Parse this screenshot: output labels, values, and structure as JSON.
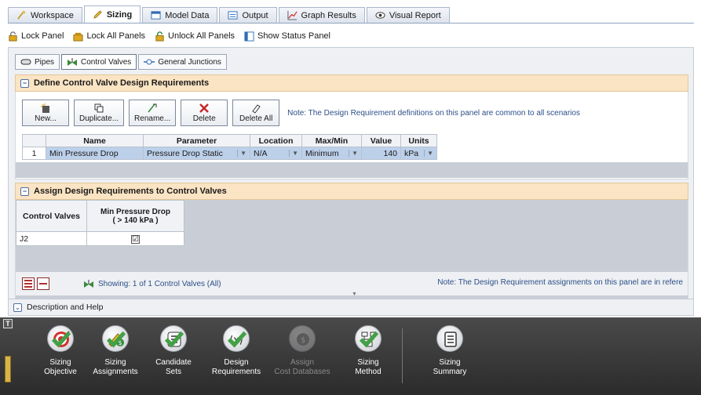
{
  "tabs": [
    {
      "label": "Workspace",
      "icon": "workspace-icon"
    },
    {
      "label": "Sizing",
      "icon": "pencil-icon",
      "active": true
    },
    {
      "label": "Model Data",
      "icon": "model-data-icon"
    },
    {
      "label": "Output",
      "icon": "output-icon"
    },
    {
      "label": "Graph Results",
      "icon": "graph-icon"
    },
    {
      "label": "Visual Report",
      "icon": "eye-icon"
    }
  ],
  "toolbar": {
    "lock_panel": "Lock Panel",
    "lock_all": "Lock All Panels",
    "unlock_all": "Unlock All Panels",
    "show_status": "Show Status Panel"
  },
  "subtabs": {
    "pipes": "Pipes",
    "control_valves": "Control Valves",
    "general_junctions": "General Junctions"
  },
  "define_section": {
    "title": "Define Control Valve Design Requirements",
    "buttons": {
      "new": "New...",
      "duplicate": "Duplicate...",
      "rename": "Rename...",
      "delete": "Delete",
      "delete_all": "Delete All"
    },
    "note": "Note: The Design Requirement definitions on this panel are common to all scenarios",
    "columns": {
      "name": "Name",
      "parameter": "Parameter",
      "location": "Location",
      "maxmin": "Max/Min",
      "value": "Value",
      "units": "Units"
    },
    "row": {
      "index": "1",
      "name": "Min Pressure Drop",
      "parameter": "Pressure Drop Static",
      "location": "N/A",
      "maxmin": "Minimum",
      "value": "140",
      "units": "kPa"
    }
  },
  "assign_section": {
    "title": "Assign Design Requirements to Control Valves",
    "col_valves": "Control Valves",
    "col_req_line1": "Min Pressure Drop",
    "col_req_line2": "( > 140 kPa )",
    "row_valve": "J2",
    "row_checked": "☑",
    "showing": "Showing: 1 of 1 Control Valves (All)",
    "note": "Note: The Design Requirement assignments on this panel are in refere"
  },
  "description_bar": {
    "label": "Description and Help"
  },
  "ribbon": {
    "t_label": "T",
    "buttons": [
      {
        "line1": "Sizing",
        "line2": "Objective",
        "icon": "target-icon",
        "enabled": true
      },
      {
        "line1": "Sizing",
        "line2": "Assignments",
        "icon": "pencil-dollar-icon",
        "enabled": true
      },
      {
        "line1": "Candidate",
        "line2": "Sets",
        "icon": "list-icon",
        "enabled": true
      },
      {
        "line1": "Design",
        "line2": "Requirements",
        "icon": "variable-x-icon",
        "enabled": true
      },
      {
        "line1": "Assign",
        "line2": "Cost Databases",
        "icon": "coin-icon",
        "enabled": false
      },
      {
        "line1": "Sizing",
        "line2": "Method",
        "icon": "flowchart-icon",
        "enabled": true
      },
      {
        "line1": "Sizing",
        "line2": "Summary",
        "icon": "summary-icon",
        "enabled": true
      }
    ]
  },
  "colors": {
    "section_header": "#fbe4c3",
    "selected_cell": "#bcd0ea",
    "ribbon_bg": "#3a3a3a",
    "checkmark": "#43a047",
    "link_text": "#2c4f88"
  }
}
